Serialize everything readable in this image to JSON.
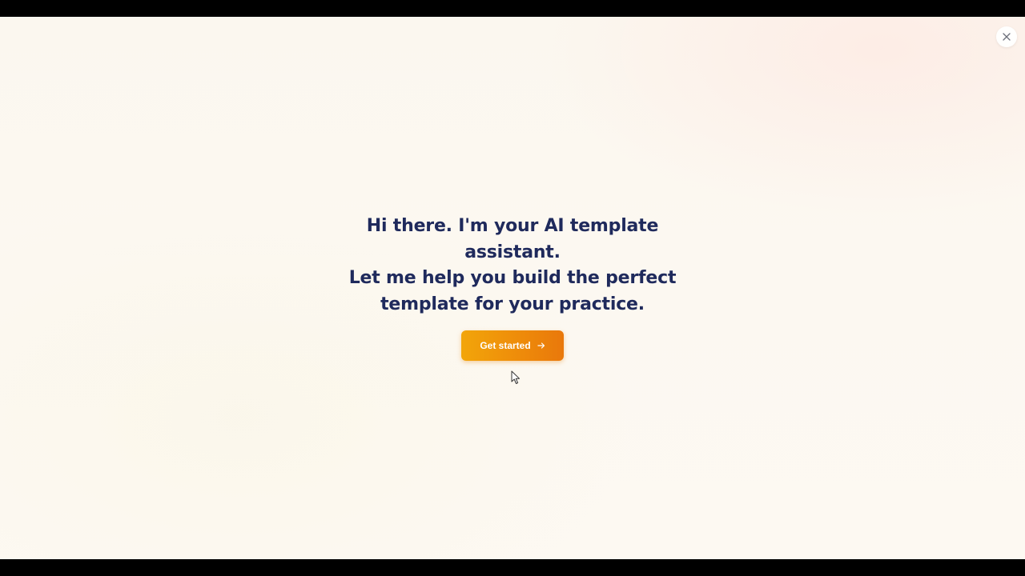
{
  "modal": {
    "close_icon": "close-icon",
    "heading_lines": [
      "Hi there. I'm your AI template",
      "assistant.",
      "Let me help you build the perfect",
      "template for your practice."
    ],
    "cta": {
      "label": "Get started",
      "icon": "arrow-right-icon"
    }
  },
  "colors": {
    "heading": "#1f2a5c",
    "accent": "#ee8a0a",
    "background": "#fcf8f1"
  }
}
